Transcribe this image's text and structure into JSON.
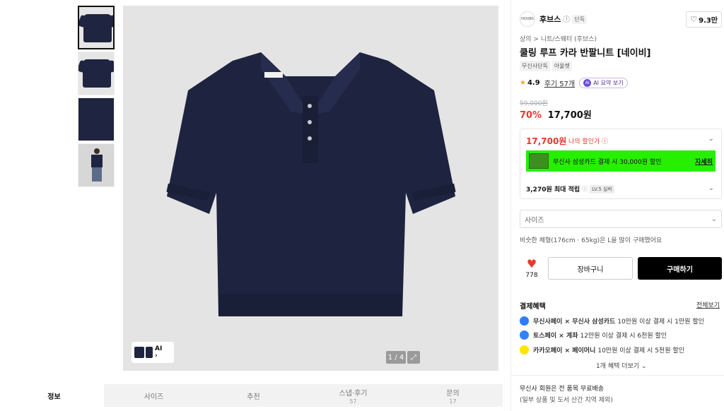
{
  "gallery": {
    "counter": "1 / 4",
    "mini_label": "AI",
    "mini_arrow": "›",
    "expand_icon": "⤢"
  },
  "tabs": [
    {
      "label": "정보",
      "count": ""
    },
    {
      "label": "사이즈",
      "count": ""
    },
    {
      "label": "추천",
      "count": ""
    },
    {
      "label": "스냅·후기",
      "count": "57"
    },
    {
      "label": "문의",
      "count": "17"
    }
  ],
  "brand": {
    "logo": "HOUBS",
    "name": "후브스",
    "info_icon": "i",
    "tag": "단독",
    "likes": "9.3만"
  },
  "product": {
    "breadcrumb": "상의 > 니트/스웨터 (후브스)",
    "title": "쿨링 루프 카라 반팔니트 [네이비]",
    "tags": [
      "무신사단독",
      "아울렛"
    ],
    "rating": "4.9",
    "reviews": "후기 57개",
    "ai_badge_icon": "AI",
    "ai_badge": "AI 요약 보기",
    "original_price": "59,000원",
    "discount": "70%",
    "price": "17,700원"
  },
  "benefit": {
    "my_price": "17,700원",
    "my_price_label": "나의 할인가 ⓘ",
    "card_text": "무신사 삼성카드 결제 시 30,000원 할인",
    "card_detail": "자세히",
    "points": "3,270원 최대 적립",
    "points_info": "ⓘ",
    "level": "LV.5 실버",
    "chevron": "⌄"
  },
  "size": {
    "placeholder": "사이즈",
    "similar": "비슷한 체형(176cm · 65kg)은 L을 많이 구매했어요"
  },
  "actions": {
    "wish_count": "778",
    "cart": "장바구니",
    "buy": "구매하기"
  },
  "payment": {
    "title": "결제혜택",
    "view_all": "전체보기",
    "rows": [
      {
        "brand": "무신사페이 × 무신사 삼성카드",
        "text": "10만원 이상 결제 시 1만원 할인",
        "color": "#2f7cf6"
      },
      {
        "brand": "토스페이 × 계좌",
        "text": "12만원 이상 결제 시 6천원 할인",
        "color": "#3182f6"
      },
      {
        "brand": "카카오페이 × 페이머니",
        "text": "10만원 이상 결제 시 5천원 할인",
        "color": "#fee500"
      }
    ],
    "more": "1개 혜택 더보기 ⌄"
  },
  "shipping": {
    "line1": "무신사 회원은 전 품목 무료배송",
    "line2": "(일부 상품 및 도서 산간 지역 제외)"
  }
}
